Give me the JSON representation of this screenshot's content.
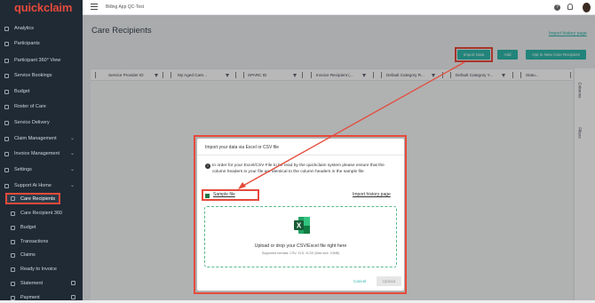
{
  "brand": {
    "logo": "quickclaim",
    "accent": "#e64a3b",
    "teal": "#2fb8aa"
  },
  "topbar": {
    "app_name": "Billing App QC-Test"
  },
  "sidebar": {
    "items": [
      {
        "label": "Analytics",
        "icon": "chart-icon"
      },
      {
        "label": "Participants",
        "icon": "people-icon"
      },
      {
        "label": "Participant 360° View",
        "icon": "eye-icon"
      },
      {
        "label": "Service Bookings",
        "icon": "calendar-icon"
      },
      {
        "label": "Budget",
        "icon": "dollar-icon"
      },
      {
        "label": "Roster of Care",
        "icon": "list-icon"
      },
      {
        "label": "Service Delivery",
        "icon": "truck-icon"
      },
      {
        "label": "Claim Management",
        "icon": "claim-icon",
        "chevron": true
      },
      {
        "label": "Invoice Management",
        "icon": "invoice-icon",
        "chevron": true
      },
      {
        "label": "Settings",
        "icon": "gear-icon",
        "chevron": true
      },
      {
        "label": "Support At Home",
        "icon": "home-icon",
        "chevron": true
      }
    ],
    "sub_items": [
      {
        "label": "Care Recipients",
        "active": true
      },
      {
        "label": "Care Recipient 360"
      },
      {
        "label": "Budget"
      },
      {
        "label": "Transactions"
      },
      {
        "label": "Claims"
      },
      {
        "label": "Ready to Invoice"
      },
      {
        "label": "Statement",
        "lock": true
      },
      {
        "label": "Payment",
        "lock": true
      }
    ]
  },
  "page": {
    "title": "Care Recipients",
    "history_link": "Import history page"
  },
  "toolbar": {
    "import_label": "Import Data",
    "add_label": "Add",
    "opt_in_label": "Opt In New Care Recipient"
  },
  "grid": {
    "columns": [
      "Service Provider ID",
      "My Aged Care...",
      "SPARC ID",
      "Invoice Recipient (...",
      "Default Category R...",
      "Default Category Y...",
      "Statu..."
    ]
  },
  "side_panel": {
    "columns_label": "Columns",
    "filters_label": "Filters"
  },
  "modal": {
    "title": "Import your data via Excel or CSV file",
    "info": "In order for your Excel/CSV File to be read by the quickclaim system please ensure that the column headers in your file are identical to the column headers in the sample file",
    "sample_file": "Sample file",
    "import_history": "Import history page",
    "drop_text": "Upload or drop your CSV/Excel file right here",
    "drop_sub": "Supported formats: CSV, XLS, XLSX (Max size: 10MB)",
    "cancel": "Cancel",
    "upload": "Upload"
  }
}
